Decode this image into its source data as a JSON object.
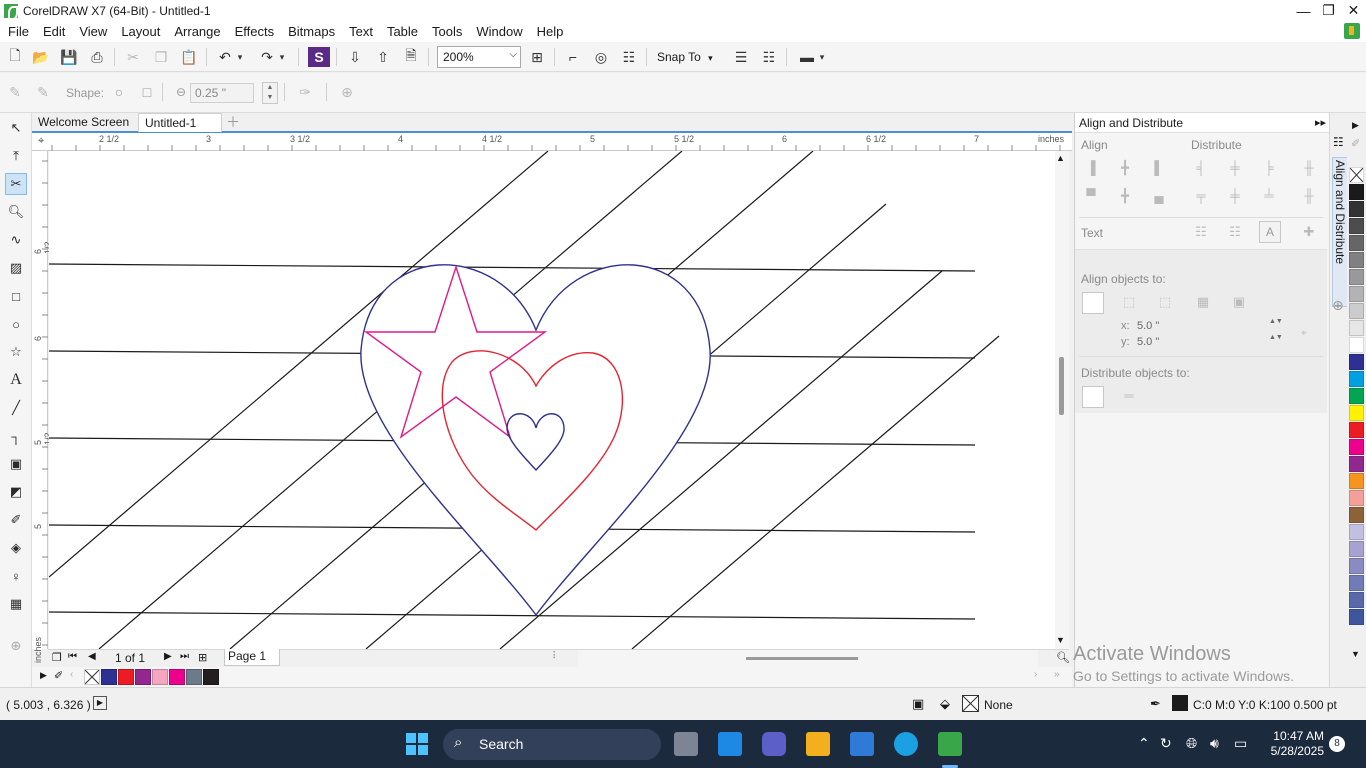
{
  "window": {
    "title": "CorelDRAW X7 (64-Bit) - Untitled-1"
  },
  "menu": [
    "File",
    "Edit",
    "View",
    "Layout",
    "Arrange",
    "Effects",
    "Bitmaps",
    "Text",
    "Table",
    "Tools",
    "Window",
    "Help"
  ],
  "toolbar": {
    "zoom": "200%",
    "snap_to": "Snap To"
  },
  "propbar": {
    "shape_label": "Shape:",
    "nib_size": "0.25 \""
  },
  "tabs": [
    "Welcome Screen",
    "Untitled-1"
  ],
  "ruler": {
    "h_labels": [
      "2 1/2",
      "3",
      "3 1/2",
      "4",
      "4 1/2",
      "5",
      "5 1/2",
      "6",
      "6 1/2",
      "7"
    ],
    "h_units": "inches",
    "v_labels": [
      "6 1/2",
      "6",
      "5 1/2",
      "5"
    ],
    "v_units": "inches"
  },
  "page_nav": {
    "counter": "1 of 1",
    "page_tab": "Page 1"
  },
  "docker": {
    "title": "Align and Distribute",
    "align": "Align",
    "distribute": "Distribute",
    "text": "Text",
    "align_objects_to": "Align objects to:",
    "x_label": "x:",
    "x_value": "5.0 \"",
    "y_label": "y:",
    "y_value": "5.0 \"",
    "distribute_objects_to": "Distribute objects to:",
    "side_tab": "Align and Distribute"
  },
  "palette": {
    "colors": [
      "#ffffff",
      "#1a1a1a",
      "#333333",
      "#4d4d4d",
      "#666666",
      "#808080",
      "#999999",
      "#b3b3b3",
      "#cccccc",
      "#e6e6e6",
      "#ffffff",
      "#2e3192",
      "#00a0e3",
      "#00a651",
      "#fff200",
      "#ed1c24",
      "#ec008c",
      "#92278f",
      "#f7941d",
      "#f4a09a",
      "#8c6239",
      "#c2bfe0",
      "#a6a2d1",
      "#8a8bc2",
      "#6f7cb6",
      "#5769ab",
      "#3f569f"
    ]
  },
  "doc_palette": [
    "#2e3192",
    "#ed1c24",
    "#92278f",
    "#f4a6c0",
    "#ec008c",
    "#6d7a8a",
    "#231f20"
  ],
  "status": {
    "coords": "( 5.003 , 6.326  )",
    "fill": "None",
    "outline": "C:0 M:0 Y:0 K:100  0.500 pt"
  },
  "watermark": {
    "line1": "Activate Windows",
    "line2": "Go to Settings to activate Windows."
  },
  "taskbar": {
    "search": "Search",
    "time": "10:47 AM",
    "date": "5/28/2025",
    "notifications": "8"
  }
}
